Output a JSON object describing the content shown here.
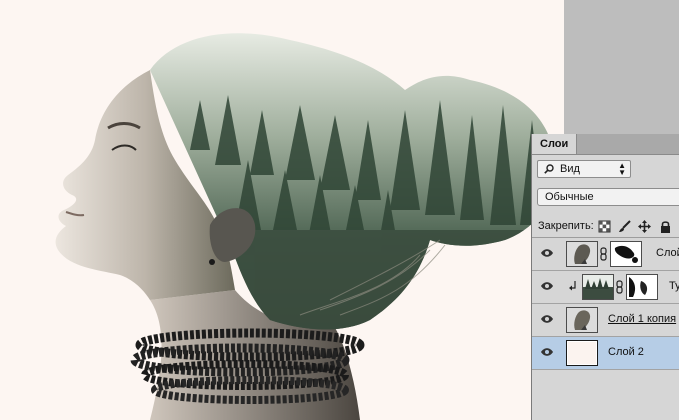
{
  "panel": {
    "tab_label": "Слои",
    "filter_label": "Вид",
    "blend_mode": "Обычные",
    "lock_label": "Закрепить:",
    "layers": [
      {
        "name": "Слой",
        "visible": true,
        "selected": false,
        "has_mask": true
      },
      {
        "name": "Ту",
        "visible": true,
        "selected": false,
        "has_mask": true,
        "clipped": true
      },
      {
        "name": "Слой 1 копия",
        "visible": true,
        "selected": false,
        "has_mask": false,
        "underlined": true
      },
      {
        "name": "Слой 2",
        "visible": true,
        "selected": true,
        "has_mask": false
      }
    ]
  },
  "colors": {
    "canvas_bg": "#fdf6f2",
    "panel_bg": "#d6d6d6",
    "selected_row": "#b6cde6",
    "workspace": "#bdbdbd"
  },
  "icons": [
    "search-icon",
    "lock-pixels-icon",
    "lock-paint-icon",
    "lock-move-icon",
    "lock-all-icon",
    "eye-icon",
    "chain-link-icon",
    "clip-arrow-icon"
  ]
}
